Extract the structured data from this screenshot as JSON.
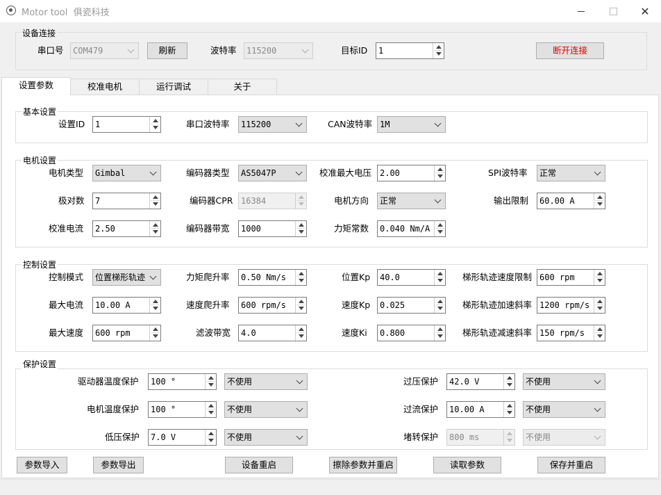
{
  "window": {
    "title": "Motor tool",
    "subtitle": "俱瓷科技"
  },
  "connection": {
    "group_title": "设备连接",
    "port_label": "串口号",
    "port_value": "COM479",
    "refresh_label": "刷新",
    "baud_label": "波特率",
    "baud_value": "115200",
    "target_id_label": "目标ID",
    "target_id_value": "1",
    "disconnect_label": "断开连接"
  },
  "tabs": [
    {
      "label": "设置参数",
      "active": true
    },
    {
      "label": "校准电机",
      "active": false
    },
    {
      "label": "运行调试",
      "active": false
    },
    {
      "label": "关于",
      "active": false
    }
  ],
  "basic": {
    "group_title": "基本设置",
    "set_id_label": "设置ID",
    "set_id_value": "1",
    "uart_baud_label": "串口波特率",
    "uart_baud_value": "115200",
    "can_baud_label": "CAN波特率",
    "can_baud_value": "1M"
  },
  "motor": {
    "group_title": "电机设置",
    "motor_type_label": "电机类型",
    "motor_type_value": "Gimbal",
    "encoder_type_label": "编码器类型",
    "encoder_type_value": "AS5047P",
    "cal_max_voltage_label": "校准最大电压",
    "cal_max_voltage_value": "2.00",
    "spi_baud_label": "SPI波特率",
    "spi_baud_value": "正常",
    "pole_pairs_label": "极对数",
    "pole_pairs_value": "7",
    "encoder_cpr_label": "编码器CPR",
    "encoder_cpr_value": "16384",
    "direction_label": "电机方向",
    "direction_value": "正常",
    "output_limit_label": "输出限制",
    "output_limit_value": "60.00 A",
    "cal_current_label": "校准电流",
    "cal_current_value": "2.50",
    "encoder_bw_label": "编码器带宽",
    "encoder_bw_value": "1000",
    "torque_const_label": "力矩常数",
    "torque_const_value": "0.040 Nm/A"
  },
  "control": {
    "group_title": "控制设置",
    "mode_label": "控制模式",
    "mode_value": "位置梯形轨迹",
    "torque_ramp_label": "力矩爬升率",
    "torque_ramp_value": "0.50 Nm/s",
    "pos_kp_label": "位置Kp",
    "pos_kp_value": "40.0",
    "traj_vel_limit_label": "梯形轨迹速度限制",
    "traj_vel_limit_value": "600 rpm",
    "max_current_label": "最大电流",
    "max_current_value": "10.00 A",
    "vel_ramp_label": "速度爬升率",
    "vel_ramp_value": "600 rpm/s",
    "vel_kp_label": "速度Kp",
    "vel_kp_value": "0.025",
    "traj_accel_label": "梯形轨迹加速斜率",
    "traj_accel_value": "1200 rpm/s",
    "max_speed_label": "最大速度",
    "max_speed_value": "600 rpm",
    "filter_bw_label": "滤波带宽",
    "filter_bw_value": "4.0",
    "vel_ki_label": "速度Ki",
    "vel_ki_value": "0.800",
    "traj_decel_label": "梯形轨迹减速斜率",
    "traj_decel_value": "150 rpm/s"
  },
  "protection": {
    "group_title": "保护设置",
    "driver_temp_label": "驱动器温度保护",
    "driver_temp_value": "100 °",
    "driver_temp_mode": "不使用",
    "overvolt_label": "过压保护",
    "overvolt_value": "42.0 V",
    "overvolt_mode": "不使用",
    "motor_temp_label": "电机温度保护",
    "motor_temp_value": "100 °",
    "motor_temp_mode": "不使用",
    "overcurrent_label": "过流保护",
    "overcurrent_value": "10.00 A",
    "overcurrent_mode": "不使用",
    "undervolt_label": "低压保护",
    "undervolt_value": "7.0 V",
    "undervolt_mode": "不使用",
    "stall_label": "堵转保护",
    "stall_value": "800 ms",
    "stall_mode": "不使用"
  },
  "actions": {
    "import_label": "参数导入",
    "export_label": "参数导出",
    "restart_label": "设备重启",
    "erase_restart_label": "擦除参数并重启",
    "read_label": "读取参数",
    "save_restart_label": "保存并重启"
  }
}
